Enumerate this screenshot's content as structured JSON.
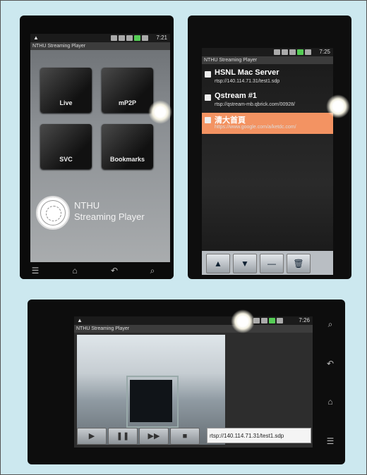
{
  "panel1": {
    "status": {
      "alert": "▲",
      "time": "7:21"
    },
    "title": "NTHU Streaming Player",
    "tiles": [
      "Live",
      "mP2P",
      "SVC",
      "Bookmarks"
    ],
    "logo_line1": "NTHU",
    "logo_line2": "Streaming Player",
    "nav": {
      "menu": "☰",
      "home": "⌂",
      "back": "↶",
      "search": "⌕"
    }
  },
  "panel2": {
    "status": {
      "time": "7:25"
    },
    "title": "NTHU Streaming Player",
    "bookmarks": [
      {
        "name": "HSNL Mac Server",
        "url": "rtsp://140.114.71.31/test1.sdp",
        "selected": false
      },
      {
        "name": "Qstream #1",
        "url": "rtsp://qstream-mb.qbrick.com/00928/",
        "selected": false
      },
      {
        "name": "清大首頁",
        "url": "https://www.google.com/a/ketdc.com/",
        "selected": true
      }
    ],
    "toolbar": {
      "up": "▲",
      "down": "▼",
      "edit": "—",
      "delete": "🗑"
    }
  },
  "panel3": {
    "status": {
      "alert": "▲",
      "time": "7:26"
    },
    "title": "NTHU Streaming Player",
    "controls": {
      "play": "▶",
      "pause": "❚❚",
      "forward": "▶▶",
      "stop": "■"
    },
    "url": "rtsp://140.114.71.31/test1.sdp",
    "side": {
      "search": "⌕",
      "back": "↶",
      "home": "⌂",
      "menu": "☰"
    }
  },
  "colors": {
    "background": "#cce8ef",
    "highlight": "#f39362"
  }
}
